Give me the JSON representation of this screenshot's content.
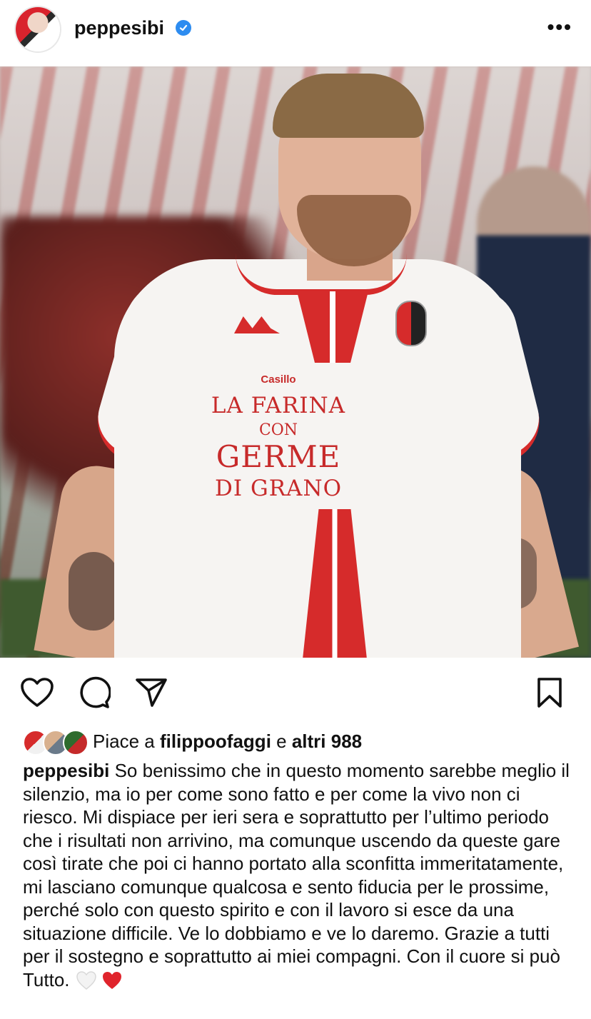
{
  "post": {
    "username": "peppesibi",
    "verified": true,
    "more_icon": "more-horizontal-icon",
    "more_label": "•••"
  },
  "photo": {
    "sponsor_brand": "Casillo",
    "sponsor_line1": "LA FARINA",
    "sponsor_line2": "CON",
    "sponsor_line3": "GERME",
    "sponsor_line4": "DI GRANO"
  },
  "actions": {
    "like_icon": "heart-icon",
    "comment_icon": "comment-icon",
    "share_icon": "send-icon",
    "save_icon": "bookmark-icon"
  },
  "likes": {
    "prefix": "Piace a ",
    "user": "filippoofaggi",
    "middle": " e ",
    "others": "altri 988"
  },
  "caption": {
    "username": "peppesibi",
    "text": " So benissimo che in questo momento sarebbe meglio il silenzio, ma io per come sono fatto e per come la vivo non ci riesco. Mi dispiace per ieri sera e soprattutto per l’ultimo periodo che i risultati non arrivino, ma comunque uscendo da queste gare così tirate che poi ci hanno portato alla sconfitta immeritatamente, mi lasciano comunque qualcosa e sento fiducia per le prossime, perché solo con questo spirito e con il lavoro si esce da una situazione difficile. Ve lo dobbiamo e ve lo daremo. Grazie a tutti per il sostegno e soprattutto ai miei compagni. Con il cuore si può Tutto.",
    "emoji": [
      "white-heart-icon",
      "red-heart-icon"
    ]
  },
  "colors": {
    "verified": "#2d8cf0",
    "shirt_red": "#d62b2b",
    "heart_red": "#e0242c"
  }
}
